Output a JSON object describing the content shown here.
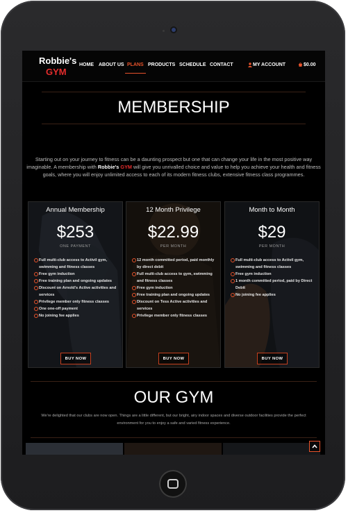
{
  "brand": {
    "line1": "Robbie's",
    "line2": "GYM"
  },
  "nav": {
    "items": [
      {
        "label": "HOME"
      },
      {
        "label": "ABOUT US"
      },
      {
        "label": "PLANS"
      },
      {
        "label": "PRODUCTS"
      },
      {
        "label": "SCHEDULE"
      },
      {
        "label": "CONTACT"
      }
    ],
    "account_label": "MY ACCOUNT",
    "cart_label": "$0.00",
    "active": "PLANS"
  },
  "membership": {
    "title": "MEMBERSHIP",
    "intro_1": "Starting out on your journey to fitness can be a daunting prospect but one that can change your life in the most positive way imaginable. A membership with ",
    "intro_brand_1": "Robbie's",
    "intro_brand_2": "GYM",
    "intro_2": " will give you unrivalled choice and value to help you achieve your health and fitness goals, where you will enjoy unlimited access to each of its modern fitness clubs, extensive fitness class programmes."
  },
  "plans": [
    {
      "title": "Annual Membership",
      "price": "$253",
      "period": "ONE PAYMENT",
      "features": [
        "Full multi-club access to Activil gym, swimming and fitness classes",
        "Free gym induction",
        "Free training plan and ongoing updates",
        "Discount on Arnold's Active activities and services",
        "Privilege member only fitness classes",
        "One one-off payment",
        "No joining fee applies"
      ],
      "button": "BUY NOW"
    },
    {
      "title": "12 Month Privilege",
      "price": "$22.99",
      "period": "PER MONTH",
      "features": [
        "12 month committed period, paid monthly by direct debit",
        "Full multi-club access to gym, swimming and fitness classes",
        "Free gym induction",
        "Free training plan and ongoing updates",
        "Discount on Tess Active activities and services",
        "Privilege member only fitness classes"
      ],
      "button": "BUY NOW"
    },
    {
      "title": "Month to Month",
      "price": "$29",
      "period": "PER MONTH",
      "features": [
        "Full multi-club access to Activil gym, swimming and fitness classes",
        "Free gym induction",
        "1 month committed period, paid by Direct Debit",
        "No joining fee applies"
      ],
      "button": "BUY NOW"
    }
  ],
  "our_gym": {
    "title": "OUR GYM",
    "text": "We're delighted that our clubs are now open. Things are a little different, but our bright, airy indoor spaces and diverse outdoor facilities provide the perfect environment for you to enjoy a safe and varied fitness experience."
  },
  "colors": {
    "accent": "#e8532b",
    "brand_red": "#e52d2d",
    "background": "#000000",
    "device": "#1d1d1f"
  },
  "icons": [
    "user-icon",
    "cart-icon",
    "check-circle-icon",
    "chevron-up-icon",
    "camera-icon",
    "home-button-icon"
  ]
}
